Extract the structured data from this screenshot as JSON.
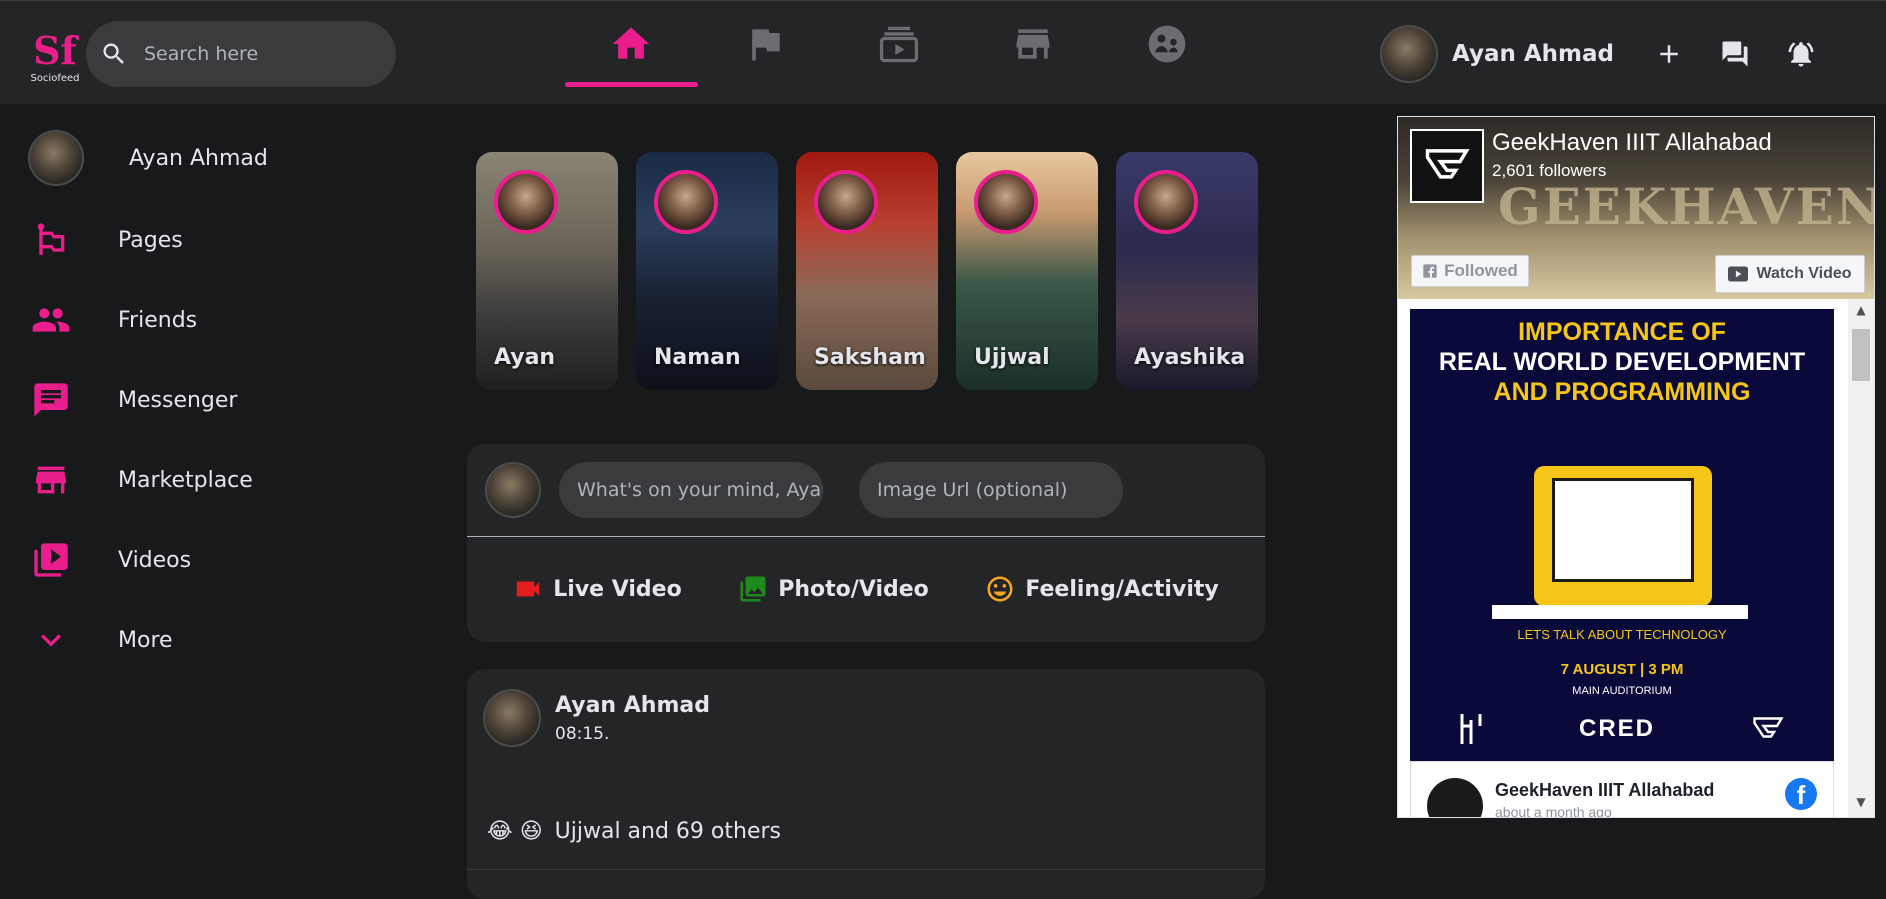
{
  "brand": {
    "logo_mark": "Sf",
    "logo_text": "Sociofeed",
    "accent": "#e91e8c"
  },
  "search": {
    "placeholder": "Search here"
  },
  "topnav": {
    "items": [
      {
        "icon": "home-icon",
        "active": true
      },
      {
        "icon": "flag-icon",
        "active": false
      },
      {
        "icon": "video-subscriptions-icon",
        "active": false
      },
      {
        "icon": "storefront-icon",
        "active": false
      },
      {
        "icon": "groups-icon",
        "active": false
      }
    ]
  },
  "user": {
    "name": "Ayan Ahmad"
  },
  "sidebar": {
    "profile_name": "Ayan Ahmad",
    "items": [
      {
        "label": "Pages",
        "icon": "emoji-flags-icon"
      },
      {
        "label": "Friends",
        "icon": "people-icon"
      },
      {
        "label": "Messenger",
        "icon": "chat-icon"
      },
      {
        "label": "Marketplace",
        "icon": "storefront-icon"
      },
      {
        "label": "Videos",
        "icon": "video-library-icon"
      },
      {
        "label": "More",
        "icon": "expand-more-icon"
      }
    ]
  },
  "stories": [
    {
      "name": "Ayan"
    },
    {
      "name": "Naman"
    },
    {
      "name": "Saksham"
    },
    {
      "name": "Ujjwal"
    },
    {
      "name": "Ayashika"
    }
  ],
  "composer": {
    "message_placeholder": "What's on your mind, Ayan?",
    "image_placeholder": "Image Url (optional)",
    "live_video": "Live Video",
    "photo_video": "Photo/Video",
    "feeling_activity": "Feeling/Activity"
  },
  "post": {
    "author": "Ayan Ahmad",
    "time": "08:15.",
    "reaction_emojis": "😂 😆",
    "reactions_text": "Ujjwal and 69 others"
  },
  "fb_widget": {
    "page_name": "GeekHaven IIIT Allahabad",
    "followers": "2,601 followers",
    "banner_text": "GEEKHAVEN",
    "followed_label": "Followed",
    "watch_label": "Watch Video",
    "poster_line1": "IMPORTANCE OF",
    "poster_line2": "REAL WORLD DEVELOPMENT",
    "poster_line3": "AND PROGRAMMING",
    "poster_tagline": "LETS TALK ABOUT TECHNOLOGY",
    "poster_date": "7 AUGUST | 3 PM",
    "poster_venue": "MAIN AUDITORIUM",
    "poster_sponsor": "CRED",
    "feed_page_name": "GeekHaven IIIT Allahabad",
    "feed_meta": "about a month ago",
    "fb_letter": "f"
  }
}
